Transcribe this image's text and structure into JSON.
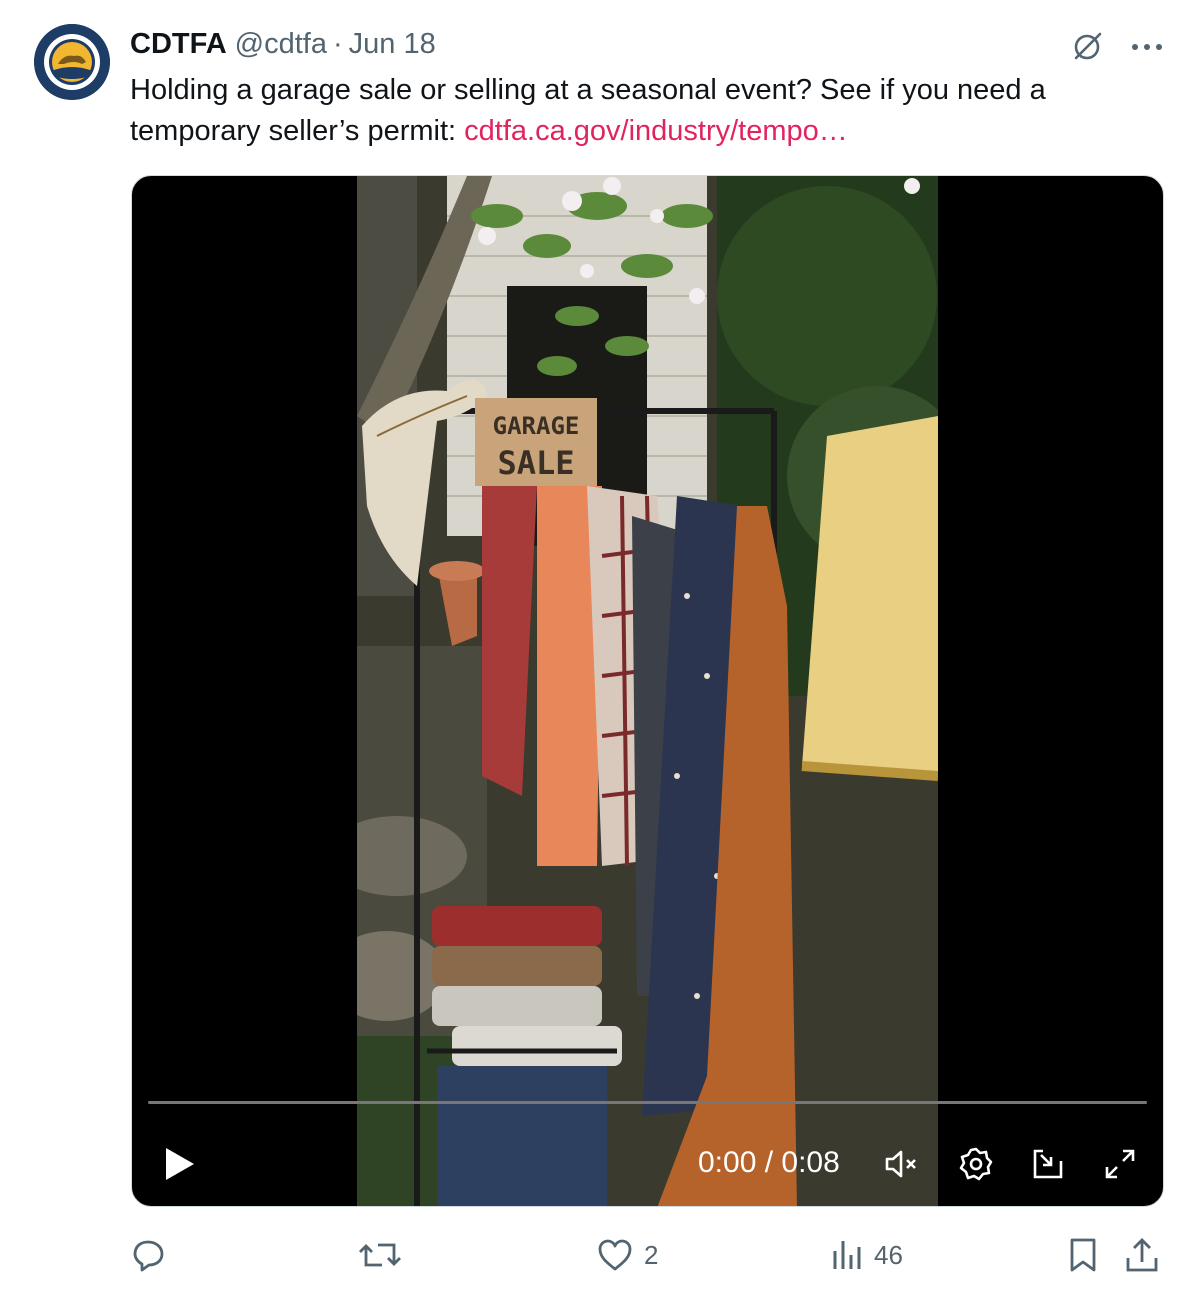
{
  "author": {
    "name": "CDTFA",
    "handle": "@cdtfa",
    "separator": "·",
    "date": "Jun 18",
    "avatar_icon": "cdtfa-seal-icon"
  },
  "tweet": {
    "text": "Holding a garage sale or selling at a seasonal event? See if you need a temporary seller’s permit: ",
    "link_text": "cdtfa.ca.gov/industry/tempo…",
    "link_color": "#e0245e"
  },
  "top_icons": [
    "grok-icon",
    "more-icon"
  ],
  "video": {
    "time": "0:00 / 0:08",
    "progress": 0,
    "sign_text": "GARAGE SALE",
    "controls": [
      "play-icon",
      "mute-icon",
      "settings-icon",
      "pip-icon",
      "fullscreen-icon"
    ]
  },
  "actions": {
    "reply_count": "",
    "repost_count": "",
    "like_count": "2",
    "views_count": "46"
  },
  "colors": {
    "text": "#0f1419",
    "secondary": "#536471",
    "link": "#e0245e"
  }
}
